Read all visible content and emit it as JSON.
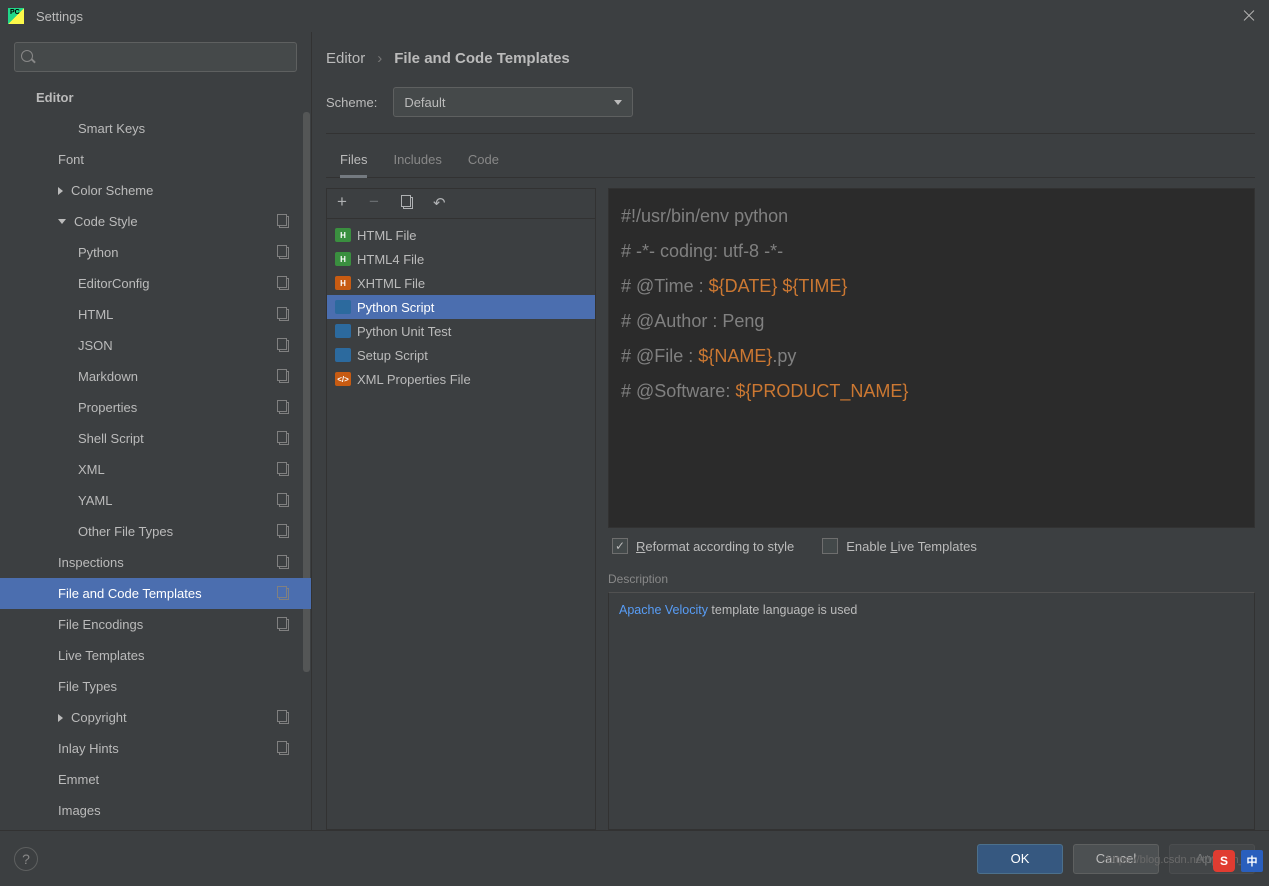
{
  "window": {
    "title": "Settings"
  },
  "sidebar": {
    "search_placeholder": "",
    "items": [
      {
        "label": "Editor",
        "type": "header"
      },
      {
        "label": "Smart Keys",
        "type": "level3"
      },
      {
        "label": "Font",
        "type": "level2"
      },
      {
        "label": "Color Scheme",
        "type": "level2",
        "arrow": "right"
      },
      {
        "label": "Code Style",
        "type": "level2",
        "arrow": "down",
        "copy": true
      },
      {
        "label": "Python",
        "type": "level3",
        "copy": true
      },
      {
        "label": "EditorConfig",
        "type": "level3",
        "copy": true
      },
      {
        "label": "HTML",
        "type": "level3",
        "copy": true
      },
      {
        "label": "JSON",
        "type": "level3",
        "copy": true
      },
      {
        "label": "Markdown",
        "type": "level3",
        "copy": true
      },
      {
        "label": "Properties",
        "type": "level3",
        "copy": true
      },
      {
        "label": "Shell Script",
        "type": "level3",
        "copy": true
      },
      {
        "label": "XML",
        "type": "level3",
        "copy": true
      },
      {
        "label": "YAML",
        "type": "level3",
        "copy": true
      },
      {
        "label": "Other File Types",
        "type": "level3",
        "copy": true
      },
      {
        "label": "Inspections",
        "type": "level2",
        "copy": true
      },
      {
        "label": "File and Code Templates",
        "type": "level2",
        "copy": true,
        "selected": true
      },
      {
        "label": "File Encodings",
        "type": "level2",
        "copy": true
      },
      {
        "label": "Live Templates",
        "type": "level2"
      },
      {
        "label": "File Types",
        "type": "level2"
      },
      {
        "label": "Copyright",
        "type": "level2",
        "arrow": "right",
        "copy": true
      },
      {
        "label": "Inlay Hints",
        "type": "level2",
        "copy": true
      },
      {
        "label": "Emmet",
        "type": "level2"
      },
      {
        "label": "Images",
        "type": "level2"
      }
    ]
  },
  "breadcrumb": {
    "a": "Editor",
    "sep": "›",
    "b": "File and Code Templates"
  },
  "scheme": {
    "label": "Scheme:",
    "value": "Default"
  },
  "tabs": [
    "Files",
    "Includes",
    "Code"
  ],
  "templates": [
    {
      "label": "HTML File",
      "icon": "html",
      "g": "H"
    },
    {
      "label": "HTML4 File",
      "icon": "html",
      "g": "H"
    },
    {
      "label": "XHTML File",
      "icon": "xhtml",
      "g": "H"
    },
    {
      "label": "Python Script",
      "icon": "py",
      "g": "",
      "selected": true
    },
    {
      "label": "Python Unit Test",
      "icon": "py",
      "g": ""
    },
    {
      "label": "Setup Script",
      "icon": "py",
      "g": ""
    },
    {
      "label": "XML Properties File",
      "icon": "xml",
      "g": "</>"
    }
  ],
  "editor": {
    "l1a": "#!/usr/bin/env python",
    "l2a": "# -*- coding: utf-8 -*-",
    "l3a": "# @Time    : ",
    "l3b": "${DATE} ${TIME}",
    "l4a": "# @Author  : Peng",
    "l5a": "# @File    : ",
    "l5b": "${NAME}",
    "l5c": ".py",
    "l6a": "# @Software: ",
    "l6b": "${PRODUCT_NAME}"
  },
  "checks": {
    "reformat": "Reformat according to style",
    "live": "Enable Live Templates",
    "reformat_checked": "✓"
  },
  "description": {
    "label": "Description",
    "link": "Apache Velocity",
    "text": " template language is used"
  },
  "buttons": {
    "ok": "OK",
    "cancel": "Cancel",
    "apply": "Apply",
    "help": "?"
  },
  "watermark": "https://blog.csdn.net/weixin_43",
  "overlay": {
    "red": "S",
    "blue": "中"
  }
}
